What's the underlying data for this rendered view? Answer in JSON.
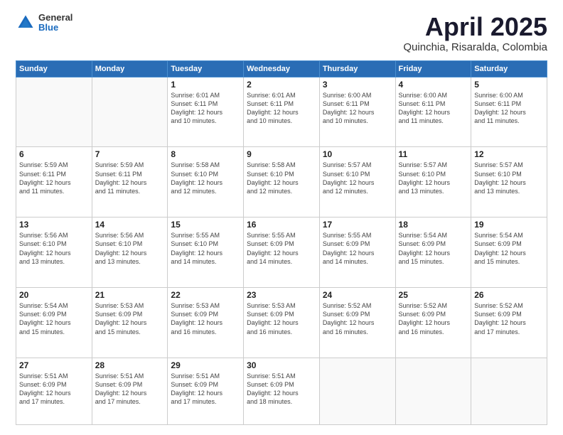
{
  "logo": {
    "general": "General",
    "blue": "Blue"
  },
  "title": {
    "month": "April 2025",
    "location": "Quinchia, Risaralda, Colombia"
  },
  "weekdays": [
    "Sunday",
    "Monday",
    "Tuesday",
    "Wednesday",
    "Thursday",
    "Friday",
    "Saturday"
  ],
  "weeks": [
    [
      {
        "day": "",
        "info": ""
      },
      {
        "day": "",
        "info": ""
      },
      {
        "day": "1",
        "info": "Sunrise: 6:01 AM\nSunset: 6:11 PM\nDaylight: 12 hours\nand 10 minutes."
      },
      {
        "day": "2",
        "info": "Sunrise: 6:01 AM\nSunset: 6:11 PM\nDaylight: 12 hours\nand 10 minutes."
      },
      {
        "day": "3",
        "info": "Sunrise: 6:00 AM\nSunset: 6:11 PM\nDaylight: 12 hours\nand 10 minutes."
      },
      {
        "day": "4",
        "info": "Sunrise: 6:00 AM\nSunset: 6:11 PM\nDaylight: 12 hours\nand 11 minutes."
      },
      {
        "day": "5",
        "info": "Sunrise: 6:00 AM\nSunset: 6:11 PM\nDaylight: 12 hours\nand 11 minutes."
      }
    ],
    [
      {
        "day": "6",
        "info": "Sunrise: 5:59 AM\nSunset: 6:11 PM\nDaylight: 12 hours\nand 11 minutes."
      },
      {
        "day": "7",
        "info": "Sunrise: 5:59 AM\nSunset: 6:11 PM\nDaylight: 12 hours\nand 11 minutes."
      },
      {
        "day": "8",
        "info": "Sunrise: 5:58 AM\nSunset: 6:10 PM\nDaylight: 12 hours\nand 12 minutes."
      },
      {
        "day": "9",
        "info": "Sunrise: 5:58 AM\nSunset: 6:10 PM\nDaylight: 12 hours\nand 12 minutes."
      },
      {
        "day": "10",
        "info": "Sunrise: 5:57 AM\nSunset: 6:10 PM\nDaylight: 12 hours\nand 12 minutes."
      },
      {
        "day": "11",
        "info": "Sunrise: 5:57 AM\nSunset: 6:10 PM\nDaylight: 12 hours\nand 13 minutes."
      },
      {
        "day": "12",
        "info": "Sunrise: 5:57 AM\nSunset: 6:10 PM\nDaylight: 12 hours\nand 13 minutes."
      }
    ],
    [
      {
        "day": "13",
        "info": "Sunrise: 5:56 AM\nSunset: 6:10 PM\nDaylight: 12 hours\nand 13 minutes."
      },
      {
        "day": "14",
        "info": "Sunrise: 5:56 AM\nSunset: 6:10 PM\nDaylight: 12 hours\nand 13 minutes."
      },
      {
        "day": "15",
        "info": "Sunrise: 5:55 AM\nSunset: 6:10 PM\nDaylight: 12 hours\nand 14 minutes."
      },
      {
        "day": "16",
        "info": "Sunrise: 5:55 AM\nSunset: 6:09 PM\nDaylight: 12 hours\nand 14 minutes."
      },
      {
        "day": "17",
        "info": "Sunrise: 5:55 AM\nSunset: 6:09 PM\nDaylight: 12 hours\nand 14 minutes."
      },
      {
        "day": "18",
        "info": "Sunrise: 5:54 AM\nSunset: 6:09 PM\nDaylight: 12 hours\nand 15 minutes."
      },
      {
        "day": "19",
        "info": "Sunrise: 5:54 AM\nSunset: 6:09 PM\nDaylight: 12 hours\nand 15 minutes."
      }
    ],
    [
      {
        "day": "20",
        "info": "Sunrise: 5:54 AM\nSunset: 6:09 PM\nDaylight: 12 hours\nand 15 minutes."
      },
      {
        "day": "21",
        "info": "Sunrise: 5:53 AM\nSunset: 6:09 PM\nDaylight: 12 hours\nand 15 minutes."
      },
      {
        "day": "22",
        "info": "Sunrise: 5:53 AM\nSunset: 6:09 PM\nDaylight: 12 hours\nand 16 minutes."
      },
      {
        "day": "23",
        "info": "Sunrise: 5:53 AM\nSunset: 6:09 PM\nDaylight: 12 hours\nand 16 minutes."
      },
      {
        "day": "24",
        "info": "Sunrise: 5:52 AM\nSunset: 6:09 PM\nDaylight: 12 hours\nand 16 minutes."
      },
      {
        "day": "25",
        "info": "Sunrise: 5:52 AM\nSunset: 6:09 PM\nDaylight: 12 hours\nand 16 minutes."
      },
      {
        "day": "26",
        "info": "Sunrise: 5:52 AM\nSunset: 6:09 PM\nDaylight: 12 hours\nand 17 minutes."
      }
    ],
    [
      {
        "day": "27",
        "info": "Sunrise: 5:51 AM\nSunset: 6:09 PM\nDaylight: 12 hours\nand 17 minutes."
      },
      {
        "day": "28",
        "info": "Sunrise: 5:51 AM\nSunset: 6:09 PM\nDaylight: 12 hours\nand 17 minutes."
      },
      {
        "day": "29",
        "info": "Sunrise: 5:51 AM\nSunset: 6:09 PM\nDaylight: 12 hours\nand 17 minutes."
      },
      {
        "day": "30",
        "info": "Sunrise: 5:51 AM\nSunset: 6:09 PM\nDaylight: 12 hours\nand 18 minutes."
      },
      {
        "day": "",
        "info": ""
      },
      {
        "day": "",
        "info": ""
      },
      {
        "day": "",
        "info": ""
      }
    ]
  ]
}
